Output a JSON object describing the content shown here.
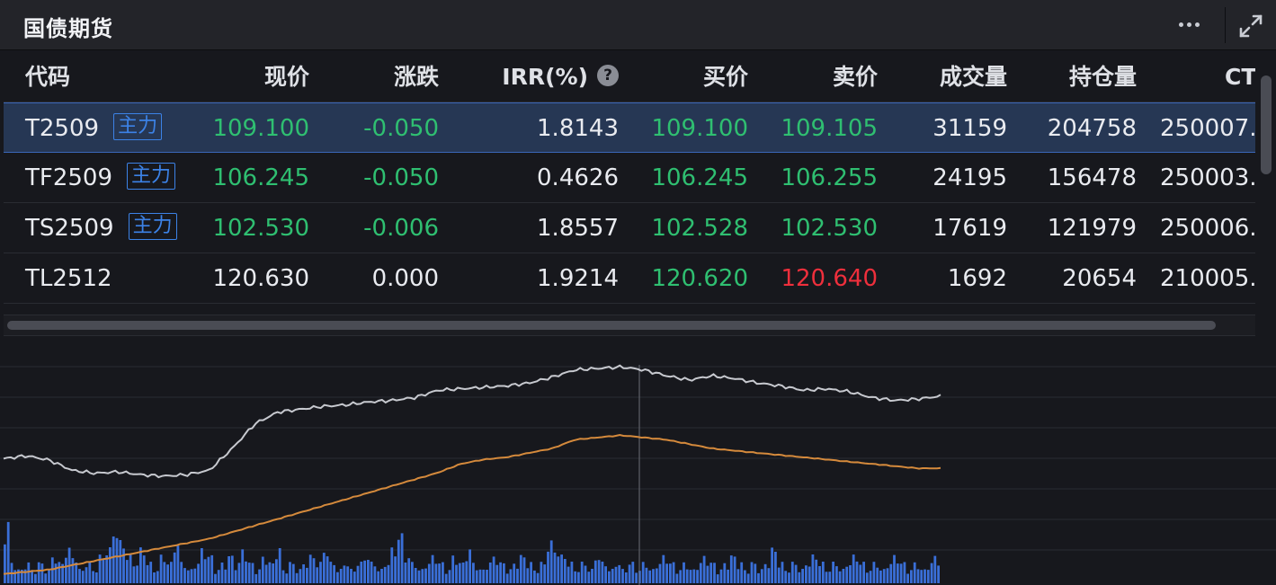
{
  "header": {
    "title": "国债期货"
  },
  "table": {
    "columns": [
      "代码",
      "现价",
      "涨跌",
      "IRR(%)",
      "买价",
      "卖价",
      "成交量",
      "持仓量",
      "CT"
    ],
    "rows": [
      {
        "code": "T2509",
        "badge": "主力",
        "price": "109.100",
        "change": "-0.050",
        "irr": "1.8143",
        "bid": "109.100",
        "ask": "109.105",
        "volume": "31159",
        "open_interest": "204758",
        "ct": "250007.",
        "price_color": "green",
        "change_color": "green",
        "bid_color": "green",
        "ask_color": "green"
      },
      {
        "code": "TF2509",
        "badge": "主力",
        "price": "106.245",
        "change": "-0.050",
        "irr": "0.4626",
        "bid": "106.245",
        "ask": "106.255",
        "volume": "24195",
        "open_interest": "156478",
        "ct": "250003.",
        "price_color": "green",
        "change_color": "green",
        "bid_color": "green",
        "ask_color": "green"
      },
      {
        "code": "TS2509",
        "badge": "主力",
        "price": "102.530",
        "change": "-0.006",
        "irr": "1.8557",
        "bid": "102.528",
        "ask": "102.530",
        "volume": "17619",
        "open_interest": "121979",
        "ct": "250006.",
        "price_color": "green",
        "change_color": "green",
        "bid_color": "green",
        "ask_color": "green"
      },
      {
        "code": "TL2512",
        "badge": "",
        "price": "120.630",
        "change": "0.000",
        "irr": "1.9214",
        "bid": "120.620",
        "ask": "120.640",
        "volume": "1692",
        "open_interest": "20654",
        "ct": "210005.",
        "price_color": "white",
        "change_color": "white",
        "bid_color": "green",
        "ask_color": "red"
      }
    ],
    "selected_row": 0
  },
  "colors": {
    "up": "#ee2f3c",
    "down": "#2fbf71",
    "accent": "#3c82e6",
    "price_line": "#c7c9cf",
    "avg_line": "#d58a3c",
    "volume_bar": "#3a6fd8"
  },
  "icons": [
    "more-icon",
    "expand-icon",
    "help-icon"
  ],
  "chart_data": {
    "type": "line",
    "series": [
      {
        "values": [
          0.38,
          0.4,
          0.37,
          0.3,
          0.28,
          0.29,
          0.27,
          0.26,
          0.27,
          0.3,
          0.45,
          0.62,
          0.7,
          0.72,
          0.74,
          0.75,
          0.77,
          0.78,
          0.8,
          0.85,
          0.86,
          0.87,
          0.88,
          0.9,
          0.94,
          0.99,
          1.0,
          1.01,
          0.99,
          0.95,
          0.92,
          0.95,
          0.93,
          0.9,
          0.88,
          0.85,
          0.86,
          0.84,
          0.8,
          0.78,
          0.79,
          0.81
        ]
      },
      {
        "values": [
          0.05,
          0.06,
          0.07,
          0.09,
          0.11,
          0.13,
          0.15,
          0.17,
          0.19,
          0.21,
          0.24,
          0.27,
          0.3,
          0.33,
          0.36,
          0.39,
          0.42,
          0.45,
          0.48,
          0.51,
          0.55,
          0.57,
          0.58,
          0.6,
          0.62,
          0.66,
          0.67,
          0.68,
          0.67,
          0.66,
          0.64,
          0.62,
          0.61,
          0.6,
          0.59,
          0.58,
          0.57,
          0.56,
          0.55,
          0.54,
          0.53,
          0.53
        ]
      }
    ],
    "volume": [
      0.9,
      0.3,
      0.2,
      0.3,
      0.2,
      0.3,
      0.2,
      0.4,
      0.3,
      0.5,
      0.4,
      0.2,
      0.3,
      0.2,
      0.4,
      0.5,
      0.8,
      0.6,
      0.4,
      0.3,
      0.5,
      0.3,
      0.2,
      0.4,
      0.3,
      0.6,
      0.3,
      0.2,
      0.3,
      0.5,
      0.4,
      0.2,
      0.3,
      0.4,
      0.3,
      0.5,
      0.3,
      0.2,
      0.4,
      0.3,
      0.5,
      0.2,
      0.3,
      0.2,
      0.3,
      0.4,
      0.3,
      0.5,
      0.3,
      0.2,
      0.3,
      0.2,
      0.3,
      0.4,
      0.3,
      0.2,
      0.3,
      0.5,
      0.7,
      0.4,
      0.3,
      0.2,
      0.3,
      0.4,
      0.3,
      0.2,
      0.4,
      0.3,
      0.5,
      0.3,
      0.2,
      0.3,
      0.4,
      0.3,
      0.2,
      0.3,
      0.4,
      0.3,
      0.2,
      0.3,
      0.6,
      0.5,
      0.4,
      0.3,
      0.2,
      0.3,
      0.2,
      0.4,
      0.3,
      0.2,
      0.3,
      0.2,
      0.3,
      0.2,
      0.3,
      0.2,
      0.3,
      0.4,
      0.3,
      0.2,
      0.3,
      0.2,
      0.3,
      0.4,
      0.3,
      0.2,
      0.3,
      0.4,
      0.3,
      0.2,
      0.3,
      0.2,
      0.3,
      0.5,
      0.3,
      0.2,
      0.3,
      0.2,
      0.3,
      0.4,
      0.3,
      0.2,
      0.3,
      0.2,
      0.3,
      0.4,
      0.3,
      0.2,
      0.3,
      0.2,
      0.3,
      0.4,
      0.3,
      0.2,
      0.3,
      0.2,
      0.3,
      0.4
    ]
  }
}
